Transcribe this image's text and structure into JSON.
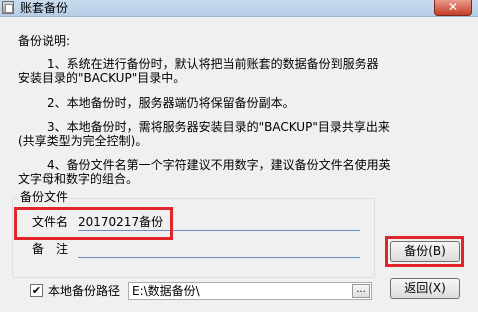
{
  "window": {
    "title": "账套备份",
    "close_label": "✕"
  },
  "description": {
    "heading": "备份说明:",
    "lines": [
      "1、系统在进行备份时，默认将把当前账套的数据备份到服务器",
      "安装目录的\"BACKUP\"目录中。",
      "2、本地备份时，服务器端仍将保留备份副本。",
      "3、本地备份时，需将服务器安装目录的\"BACKUP\"目录共享出来",
      "(共享类型为完全控制)。",
      "4、备份文件名第一个字符建议不用数字，建议备份文件名使用英",
      "文字母和数字的组合。"
    ]
  },
  "backup_file": {
    "group_title": "备份文件",
    "filename_label": "文件名",
    "filename_value": "20170217备份",
    "note_label": "备　注",
    "note_value": ""
  },
  "local_path": {
    "checkbox_label": "本地备份路径",
    "checked": true,
    "check_glyph": "✔",
    "path_value": "E:\\数据备份\\",
    "browse_label": "..."
  },
  "buttons": {
    "backup": "备份(B)",
    "back": "返回(X)"
  },
  "colors": {
    "highlight": "#e0262a",
    "titlebar": "#c9dbee",
    "close": "#c63d29"
  }
}
